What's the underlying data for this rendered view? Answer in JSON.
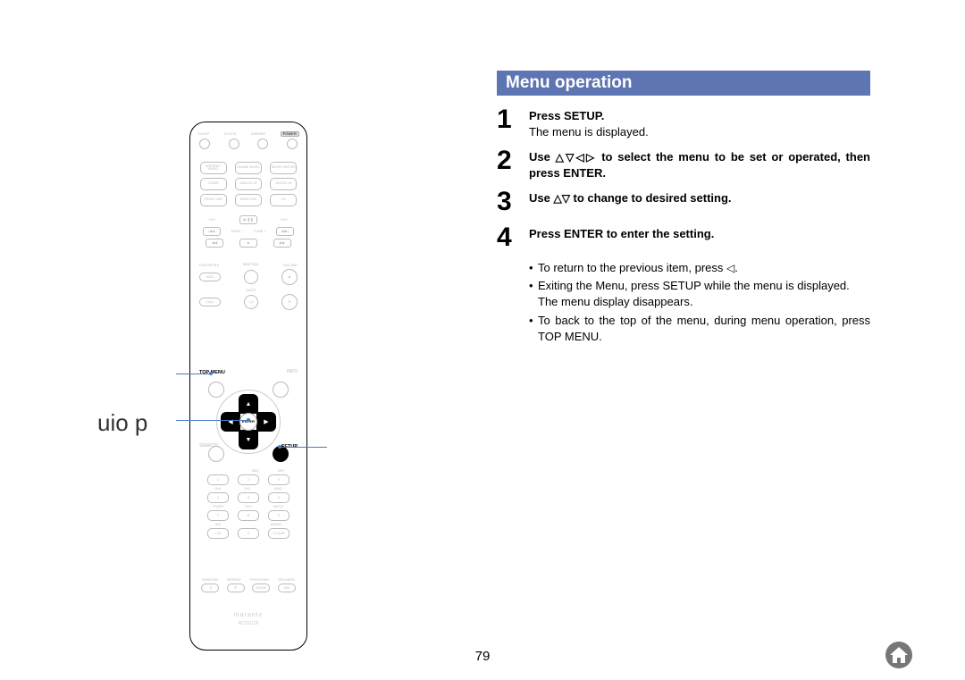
{
  "page_number": "79",
  "left_label": "uio   p",
  "heading": "Menu operation",
  "steps": [
    {
      "num": "1",
      "bold": "Press SETUP.",
      "text": "The menu is displayed."
    },
    {
      "num": "2",
      "bold_before": "Use ",
      "bold_after": " to select the menu to be set or operated, then press ENTER.",
      "arrows": "△▽◁▷"
    },
    {
      "num": "3",
      "bold_before": "Use ",
      "bold_after": " to change to desired setting.",
      "arrows": "△▽"
    },
    {
      "num": "4",
      "bold": "Press ENTER to enter the setting."
    }
  ],
  "notes": [
    {
      "t1": "To return to the previous item, press ",
      "tri": "◁",
      "t2": "."
    },
    {
      "t1": "Exiting the Menu, press SETUP while the menu is displayed. The menu display disappears."
    },
    {
      "t1": "To back to the top of the menu, during menu operation, press TOP MENU."
    }
  ],
  "remote": {
    "row1": [
      "SLEEP",
      "CLOCK",
      "DIMMER",
      "POWER"
    ],
    "src_rows": [
      [
        "INTERNET RADIO",
        "ONLINE MUSIC",
        "MUSIC SERVER"
      ],
      [
        "TUNER",
        "ANALOG IN",
        "DIGITAL IN"
      ],
      [
        "FRONT USB",
        "REAR USB",
        "CD"
      ]
    ],
    "ch_row": [
      "CH−",
      "▶/❚❚",
      "CH+"
    ],
    "tune_row": [
      "TUNE −",
      "",
      "TUNE +"
    ],
    "trans_row": [
      "◀◀",
      "■",
      "▶▶"
    ],
    "mid_left": [
      "ADD",
      "CALL"
    ],
    "mid_labels_left": "FAVORITES",
    "mid_labels_right_top": "VOLUME",
    "mid_labels_right_bot": "MUTE",
    "db_top": "DBB/TONE",
    "mid_mute": "◁×",
    "vol_up": "▲",
    "vol_down": "▼",
    "corner_labels": {
      "tl": "TOP MENU",
      "tr": "INFO",
      "bl": "SEARCH",
      "br": "SETUP"
    },
    "enter": "ENTER",
    "num_labels_top": [
      "ABC",
      "DEF"
    ],
    "num_rows": [
      [
        "1",
        "2",
        "3"
      ],
      [
        "4",
        "5",
        "6"
      ],
      [
        "7",
        "8",
        "9"
      ],
      [
        "+10",
        "0",
        "CLEAR"
      ]
    ],
    "num_labels_mid1": [
      "GHI",
      "JKL",
      "MNO"
    ],
    "num_labels_mid2": [
      "PQRS",
      "TUV",
      "WXYZ"
    ],
    "num_labels_bot": [
      "a/A",
      "",
      "MEMO"
    ],
    "bottom_row_labels": [
      "RANDOM",
      "REPEAT",
      "PROGRAM",
      "SPEAKER"
    ],
    "bottom_row": [
      "⤨",
      "↻",
      "MODE",
      "A/B"
    ],
    "brand": "marantz",
    "model": "RC011CR"
  }
}
